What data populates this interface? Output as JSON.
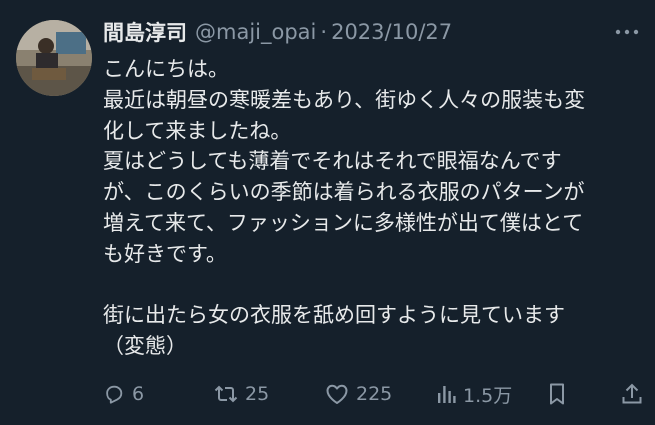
{
  "post": {
    "display_name": "間島淳司",
    "handle": "@maji_opai",
    "separator": "·",
    "date": "2023/10/27",
    "lines": [
      "こんにちは。",
      "最近は朝昼の寒暖差もあり、街ゆく人々の服装も変",
      "化して来ましたね。",
      "夏はどうしても薄着でそれはそれで眼福なんです",
      "が、このくらいの季節は着られる衣服のパターンが",
      "増えて来て、ファッションに多様性が出て僕はとて",
      "も好きです。",
      "",
      "街に出たら女の衣服を舐め回すように見ています",
      "（変態）"
    ]
  },
  "actions": {
    "replies": "6",
    "reposts": "25",
    "likes": "225",
    "views": "1.5万"
  },
  "colors": {
    "background": "#15202b",
    "text": "#e7e9ea",
    "muted": "#8b98a5"
  },
  "icons": [
    "more-icon",
    "reply-icon",
    "repost-icon",
    "like-icon",
    "views-icon",
    "bookmark-icon",
    "share-icon"
  ]
}
